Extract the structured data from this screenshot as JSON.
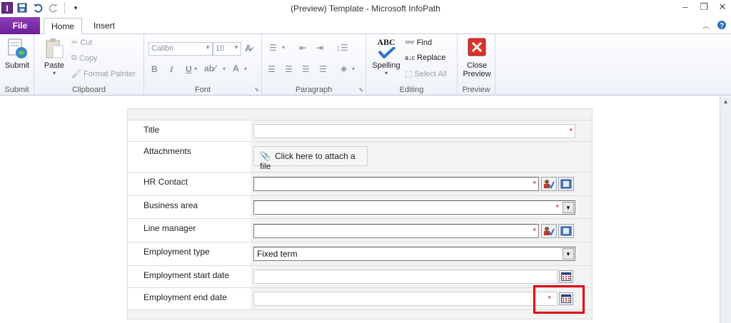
{
  "window": {
    "title": "(Preview) Template  -  Microsoft InfoPath",
    "app_icon_letter": "I"
  },
  "tabs": {
    "file": "File",
    "items": [
      "Home",
      "Insert"
    ],
    "active": "Home"
  },
  "ribbon": {
    "submit_group": {
      "label": "Submit",
      "submit_button": "Submit"
    },
    "clipboard_group": {
      "label": "Clipboard",
      "paste": "Paste",
      "cut": "Cut",
      "copy": "Copy",
      "format_painter": "Format Painter"
    },
    "font_group": {
      "label": "Font",
      "font_name": "Calibri",
      "font_size": "10",
      "bold": "B",
      "italic": "I",
      "underline": "U"
    },
    "paragraph_group": {
      "label": "Paragraph"
    },
    "editing_group": {
      "label": "Editing",
      "spelling": "Spelling",
      "spelling_icon_text": "ABC",
      "find": "Find",
      "replace": "Replace",
      "select_all": "Select All"
    },
    "preview_group": {
      "label": "Preview",
      "close_preview": "Close Preview"
    }
  },
  "form": {
    "rows": [
      {
        "label": "Title",
        "type": "text",
        "required": true
      },
      {
        "label": "Attachments",
        "type": "attachment",
        "button_text": "Click here to attach a file"
      },
      {
        "label": "HR Contact",
        "type": "person",
        "required": true
      },
      {
        "label": "Business area",
        "type": "dropdown",
        "required": true
      },
      {
        "label": "Line manager",
        "type": "person",
        "required": true
      },
      {
        "label": "Employment type",
        "type": "dropdown",
        "value": "Fixed term"
      },
      {
        "label": "Employment start date",
        "type": "date"
      },
      {
        "label": "Employment end date",
        "type": "date",
        "required": true
      }
    ],
    "required_marker": "*"
  },
  "colors": {
    "file_tab": "#7a2ea5",
    "required": "#d02020",
    "highlight": "#e0000f"
  }
}
